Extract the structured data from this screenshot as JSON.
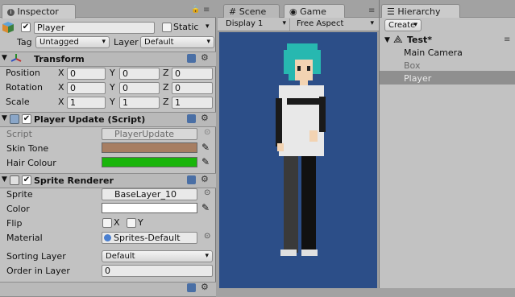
{
  "colors": {
    "skin_tone": "#a77e62",
    "hair_colour": "#19b50a",
    "color": "#ffffff",
    "game_bg": "#2c4e88",
    "hair": "#27b8b0"
  },
  "inspector": {
    "tab": "Inspector",
    "object_name": "Player",
    "static_label": "Static",
    "tag_label": "Tag",
    "tag_value": "Untagged",
    "layer_label": "Layer",
    "layer_value": "Default",
    "transform": {
      "title": "Transform",
      "rows": [
        {
          "label": "Position",
          "x": "0",
          "y": "0",
          "z": "0"
        },
        {
          "label": "Rotation",
          "x": "0",
          "y": "0",
          "z": "0"
        },
        {
          "label": "Scale",
          "x": "1",
          "y": "1",
          "z": "1"
        }
      ],
      "axis_x": "X",
      "axis_y": "Y",
      "axis_z": "Z"
    },
    "player_update": {
      "title": "Player Update (Script)",
      "script_label": "Script",
      "script_value": "PlayerUpdate",
      "skin_tone_label": "Skin Tone",
      "hair_colour_label": "Hair Colour"
    },
    "sprite_renderer": {
      "title": "Sprite Renderer",
      "sprite_label": "Sprite",
      "sprite_value": "BaseLayer_10",
      "color_label": "Color",
      "flip_label": "Flip",
      "flip_x": "X",
      "flip_y": "Y",
      "material_label": "Material",
      "material_value": "Sprites-Default",
      "sorting_layer_label": "Sorting Layer",
      "sorting_layer_value": "Default",
      "order_label": "Order in Layer",
      "order_value": "0"
    }
  },
  "scene_tab": "Scene",
  "game": {
    "tab": "Game",
    "display": "Display 1",
    "aspect": "Free Aspect"
  },
  "hierarchy": {
    "tab": "Hierarchy",
    "create": "Create",
    "scene": "Test*",
    "items": [
      "Main Camera",
      "Box",
      "Player"
    ]
  }
}
